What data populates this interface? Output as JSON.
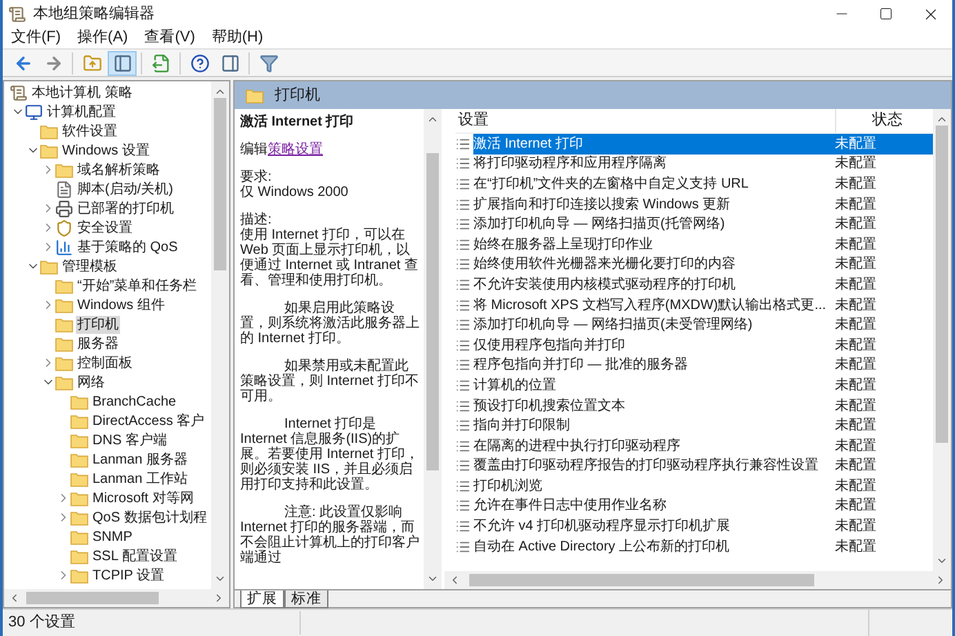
{
  "window": {
    "title": "本地组策略编辑器"
  },
  "menu": [
    "文件(F)",
    "操作(A)",
    "查看(V)",
    "帮助(H)"
  ],
  "toolbar": [
    {
      "kind": "back",
      "pressed": false
    },
    {
      "kind": "forward",
      "pressed": false
    },
    {
      "kind": "sep"
    },
    {
      "kind": "up",
      "pressed": false
    },
    {
      "kind": "tree",
      "pressed": true
    },
    {
      "kind": "sep"
    },
    {
      "kind": "export",
      "pressed": false
    },
    {
      "kind": "sep"
    },
    {
      "kind": "help",
      "pressed": false
    },
    {
      "kind": "pane",
      "pressed": false
    },
    {
      "kind": "sep"
    },
    {
      "kind": "filter",
      "pressed": false
    }
  ],
  "tree": {
    "label": "本地计算机 策略",
    "kind": "policy",
    "selected": false,
    "children": [
      {
        "label": "计算机配置",
        "kind": "computer",
        "selected": false,
        "expanded": true,
        "children": [
          {
            "label": "软件设置",
            "selected": false
          },
          {
            "label": "Windows 设置",
            "selected": false,
            "expanded": true,
            "children": [
              {
                "label": "域名解析策略",
                "selected": false,
                "expanded": false
              },
              {
                "label": "脚本(启动/关机)",
                "kind": "script",
                "selected": false
              },
              {
                "label": "已部署的打印机",
                "kind": "printer",
                "selected": false,
                "expanded": false
              },
              {
                "label": "安全设置",
                "kind": "security",
                "selected": false,
                "expanded": false
              },
              {
                "label": "基于策略的 QoS",
                "kind": "chart",
                "selected": false,
                "expanded": false
              }
            ]
          },
          {
            "label": "管理模板",
            "selected": false,
            "expanded": true,
            "children": [
              {
                "label": "“开始”菜单和任务栏",
                "selected": false
              },
              {
                "label": "Windows 组件",
                "selected": false,
                "expanded": false
              },
              {
                "label": "打印机",
                "selected": true
              },
              {
                "label": "服务器",
                "selected": false
              },
              {
                "label": "控制面板",
                "selected": false,
                "expanded": false
              },
              {
                "label": "网络",
                "selected": false,
                "expanded": true,
                "children": [
                  {
                    "label": "BranchCache",
                    "selected": false
                  },
                  {
                    "label": "DirectAccess 客户",
                    "selected": false
                  },
                  {
                    "label": "DNS 客户端",
                    "selected": false
                  },
                  {
                    "label": "Lanman 服务器",
                    "selected": false
                  },
                  {
                    "label": "Lanman 工作站",
                    "selected": false
                  },
                  {
                    "label": "Microsoft 对等网",
                    "selected": false,
                    "expanded": false
                  },
                  {
                    "label": "QoS 数据包计划程",
                    "selected": false,
                    "expanded": false
                  },
                  {
                    "label": "SNMP",
                    "selected": false
                  },
                  {
                    "label": "SSL 配置设置",
                    "selected": false
                  },
                  {
                    "label": "TCPIP 设置",
                    "selected": false,
                    "expanded": false
                  }
                ]
              }
            ]
          }
        ]
      }
    ]
  },
  "details": {
    "header": "打印机",
    "title": "激活 Internet 打印",
    "edit": {
      "prefix": "编辑",
      "link": "策略设置"
    },
    "paragraphs": [
      {
        "text": "要求:\n仅 Windows 2000",
        "indent": false
      },
      {
        "text": "描述:\n使用 Internet 打印，可以在 Web 页面上显示打印机，以便通过 Internet 或 Intranet 查看、管理和使用打印机。",
        "indent": false
      },
      {
        "text": "如果启用此策略设置，则系统将激活此服务器上的 Internet 打印。",
        "indent": true
      },
      {
        "text": "如果禁用或未配置此策略设置，则 Internet 打印不可用。",
        "indent": true
      },
      {
        "text": "Internet 打印是 Internet 信息服务(IIS)的扩展。若要使用 Internet 打印，则必须安装 IIS，并且必须启用打印支持和此设置。",
        "indent": true
      },
      {
        "text": "注意: 此设置仅影响 Internet 打印的服务器端，而不会阻止计算机上的打印客户端通过",
        "indent": true
      }
    ]
  },
  "table": {
    "columns": [
      "设置",
      "状态"
    ],
    "rows": [
      {
        "name": "激活 Internet 打印",
        "status": "未配置",
        "selected": true
      },
      {
        "name": "将打印驱动程序和应用程序隔离",
        "status": "未配置",
        "selected": false
      },
      {
        "name": "在“打印机”文件夹的左窗格中自定义支持 URL",
        "status": "未配置",
        "selected": false
      },
      {
        "name": "扩展指向和打印连接以搜索 Windows 更新",
        "status": "未配置",
        "selected": false
      },
      {
        "name": "添加打印机向导 — 网络扫描页(托管网络)",
        "status": "未配置",
        "selected": false
      },
      {
        "name": "始终在服务器上呈现打印作业",
        "status": "未配置",
        "selected": false
      },
      {
        "name": "始终使用软件光栅器来光栅化要打印的内容",
        "status": "未配置",
        "selected": false
      },
      {
        "name": "不允许安装使用内核模式驱动程序的打印机",
        "status": "未配置",
        "selected": false
      },
      {
        "name": "将 Microsoft XPS 文档写入程序(MXDW)默认输出格式更...",
        "status": "未配置",
        "selected": false
      },
      {
        "name": "添加打印机向导 — 网络扫描页(未受管理网络)",
        "status": "未配置",
        "selected": false
      },
      {
        "name": "仅使用程序包指向并打印",
        "status": "未配置",
        "selected": false
      },
      {
        "name": "程序包指向并打印 — 批准的服务器",
        "status": "未配置",
        "selected": false
      },
      {
        "name": "计算机的位置",
        "status": "未配置",
        "selected": false
      },
      {
        "name": "预设打印机搜索位置文本",
        "status": "未配置",
        "selected": false
      },
      {
        "name": "指向并打印限制",
        "status": "未配置",
        "selected": false
      },
      {
        "name": "在隔离的进程中执行打印驱动程序",
        "status": "未配置",
        "selected": false
      },
      {
        "name": "覆盖由打印驱动程序报告的打印驱动程序执行兼容性设置",
        "status": "未配置",
        "selected": false
      },
      {
        "name": "打印机浏览",
        "status": "未配置",
        "selected": false
      },
      {
        "name": "允许在事件日志中使用作业名称",
        "status": "未配置",
        "selected": false
      },
      {
        "name": "不允许 v4 打印机驱动程序显示打印机扩展",
        "status": "未配置",
        "selected": false
      },
      {
        "name": "自动在 Active Directory 上公布新的打印机",
        "status": "未配置",
        "selected": false
      }
    ]
  },
  "view_tabs": [
    {
      "label": "扩展",
      "selected": true
    },
    {
      "label": "标准",
      "selected": false
    }
  ],
  "status_bar": "30 个设置"
}
